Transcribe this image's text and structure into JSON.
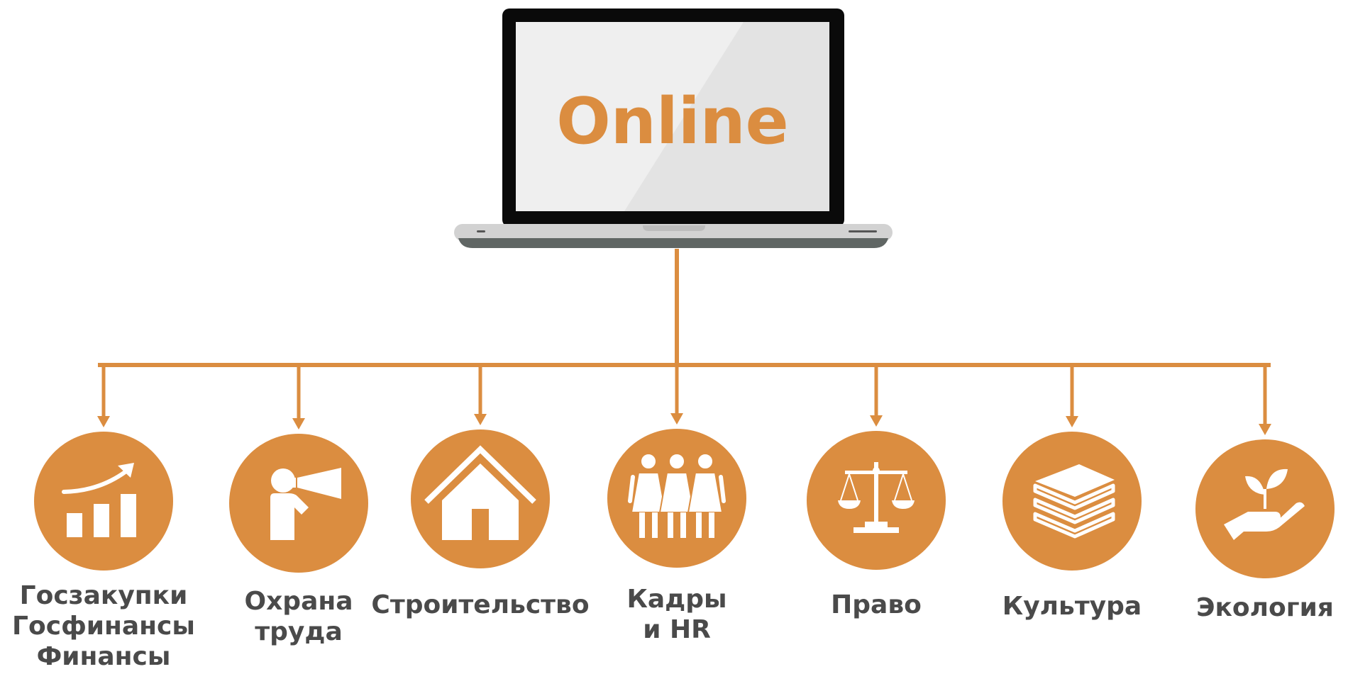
{
  "colors": {
    "accent": "#DB8D40",
    "label_text": "#4A4A4A",
    "screen_bg": "#EDEDED",
    "bezel": "#0A0A0A",
    "laptop_base": "#D2D2D2",
    "laptop_base_shadow": "#606664"
  },
  "laptop": {
    "screen_text": "Online"
  },
  "nodes": [
    {
      "id": "goszakupki",
      "icon": "growth-chart-icon",
      "lines": [
        "Госзакупки",
        "Госфинансы",
        "Финансы"
      ]
    },
    {
      "id": "ohrana-truda",
      "icon": "megaphone-person-icon",
      "lines": [
        "Охрана",
        "труда"
      ]
    },
    {
      "id": "stroitelstvo",
      "icon": "house-icon",
      "lines": [
        "Строительство"
      ]
    },
    {
      "id": "kadry",
      "icon": "people-group-icon",
      "lines": [
        "Кадры",
        "и HR"
      ]
    },
    {
      "id": "pravo",
      "icon": "scales-icon",
      "lines": [
        "Право"
      ]
    },
    {
      "id": "kultura",
      "icon": "books-icon",
      "lines": [
        "Культура"
      ]
    },
    {
      "id": "ekologiya",
      "icon": "plant-in-hand-icon",
      "lines": [
        "Экология"
      ]
    }
  ]
}
